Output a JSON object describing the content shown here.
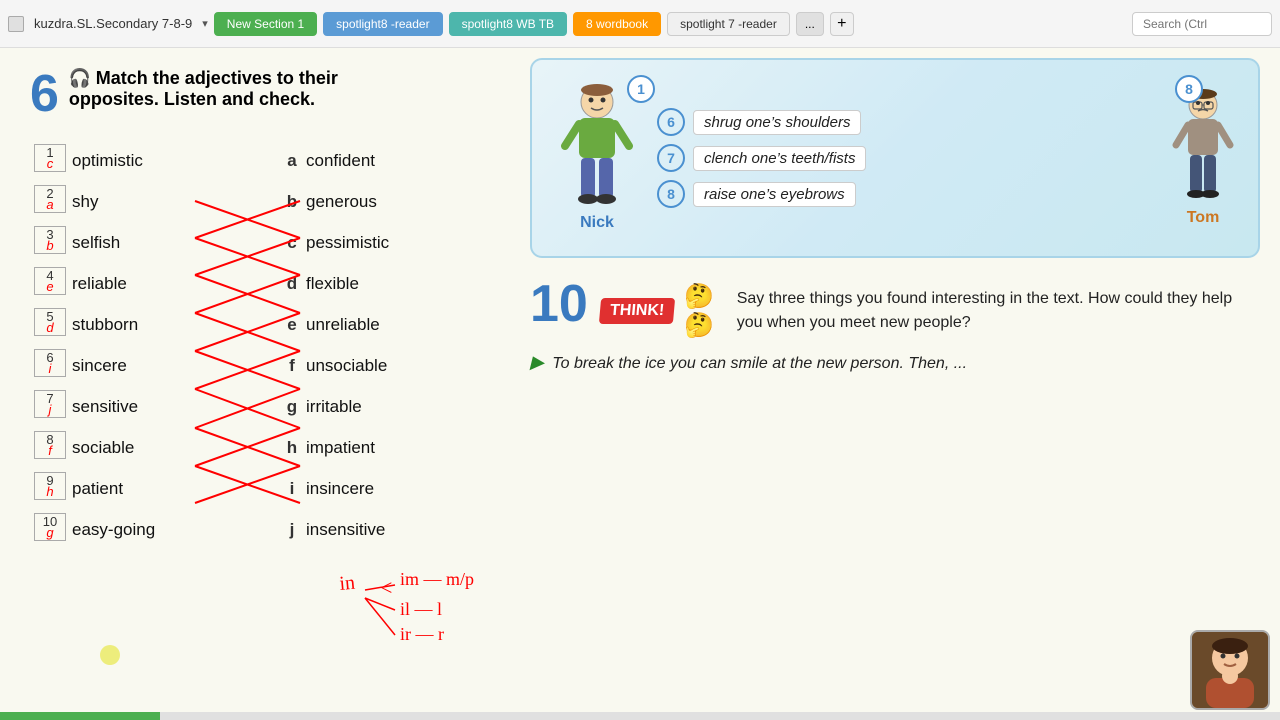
{
  "topbar": {
    "doc_title": "kuzdra.SL.Secondary 7-8-9",
    "tabs": [
      {
        "label": "New Section 1",
        "style": "active"
      },
      {
        "label": "spotlight8 -reader",
        "style": "blue"
      },
      {
        "label": "spotlight8 WB TB",
        "style": "teal"
      },
      {
        "label": "8 wordbook",
        "style": "orange"
      },
      {
        "label": "spotlight 7 -reader",
        "style": "default"
      },
      {
        "label": "...",
        "style": "more"
      }
    ],
    "search_placeholder": "Search (Ctrl"
  },
  "exercise6": {
    "number": "6",
    "instruction_line1": "Match the adjectives to their",
    "instruction_line2": "opposites. Listen and check.",
    "rows": [
      {
        "num": "1",
        "letter_answer": "c",
        "left": "optimistic",
        "right_letter": "a",
        "right": "confident"
      },
      {
        "num": "2",
        "letter_answer": "a",
        "left": "shy",
        "right_letter": "b",
        "right": "generous"
      },
      {
        "num": "3",
        "letter_answer": "b",
        "left": "selfish",
        "right_letter": "c",
        "right": "pessimistic"
      },
      {
        "num": "4",
        "letter_answer": "e",
        "left": "reliable",
        "right_letter": "d",
        "right": "flexible"
      },
      {
        "num": "5",
        "letter_answer": "d",
        "left": "stubborn",
        "right_letter": "e",
        "right": "unreliable"
      },
      {
        "num": "6",
        "letter_answer": "i",
        "left": "sincere",
        "right_letter": "f",
        "right": "unsociable"
      },
      {
        "num": "7",
        "letter_answer": "j",
        "left": "sensitive",
        "right_letter": "g",
        "right": "irritable"
      },
      {
        "num": "8",
        "letter_answer": "f",
        "left": "sociable",
        "right_letter": "h",
        "right": "impatient"
      },
      {
        "num": "9",
        "letter_answer": "h",
        "left": "patient",
        "right_letter": "i",
        "right": "insincere"
      },
      {
        "num": "10",
        "letter_answer": "g",
        "left": "easy-going",
        "right_letter": "j",
        "right": "insensitive"
      }
    ]
  },
  "characters": {
    "nick_name": "Nick",
    "tom_name": "Tom",
    "phrases": [
      {
        "num": "6",
        "text": "shrug one’s shoulders"
      },
      {
        "num": "7",
        "text": "clench one’s teeth/fists"
      },
      {
        "num": "8",
        "text": "raise one’s eyebrows"
      }
    ]
  },
  "exercise10": {
    "number": "10",
    "think_label": "THINK!",
    "question": "Say three things you found interesting in the text. How could they help you when you meet new people?",
    "sample_answer": "To break the ice you can smile at the new person. Then, ..."
  },
  "handwriting": {
    "annotation": "ih < im-m/p\n      il-l\n      ir-r"
  },
  "colors": {
    "blue": "#3a7abf",
    "red": "#e03030",
    "green": "#4caf50"
  }
}
